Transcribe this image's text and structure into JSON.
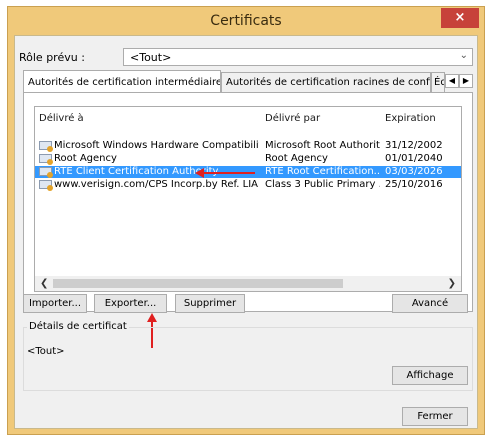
{
  "window": {
    "title": "Certificats",
    "close_glyph": "×"
  },
  "purpose": {
    "label": "Rôle prévu :",
    "value": "<Tout>"
  },
  "tabs": [
    {
      "label": "Autorités de certification intermédiaires"
    },
    {
      "label": "Autorités de certification racines de confiance"
    },
    {
      "label": "Éd"
    }
  ],
  "table": {
    "headers": [
      "Délivré à",
      "Délivré par",
      "Expiration"
    ],
    "rows": [
      {
        "issued_to": "Microsoft Windows Hardware Compatibility",
        "issued_by": "Microsoft Root Authority",
        "expiration": "31/12/2002"
      },
      {
        "issued_to": "Root Agency",
        "issued_by": "Root Agency",
        "expiration": "01/01/2040"
      },
      {
        "issued_to": "RTE Client Certification Authority",
        "issued_by": "RTE Root Certification...",
        "expiration": "03/03/2026"
      },
      {
        "issued_to": "www.verisign.com/CPS Incorp.by Ref. LIABI...",
        "issued_by": "Class 3 Public Primary ...",
        "expiration": "25/10/2016"
      }
    ],
    "selected_row": 2
  },
  "buttons": {
    "import": "Importer...",
    "export": "Exporter...",
    "remove": "Supprimer",
    "advanced": "Avancé",
    "view": "Affichage",
    "close": "Fermer"
  },
  "details": {
    "title": "Détails de certificat",
    "value": "<Tout>"
  },
  "colors": {
    "titlebar": "#f0c97a",
    "selection": "#3399ff",
    "close": "#c7423a",
    "annotation": "#e02020"
  }
}
